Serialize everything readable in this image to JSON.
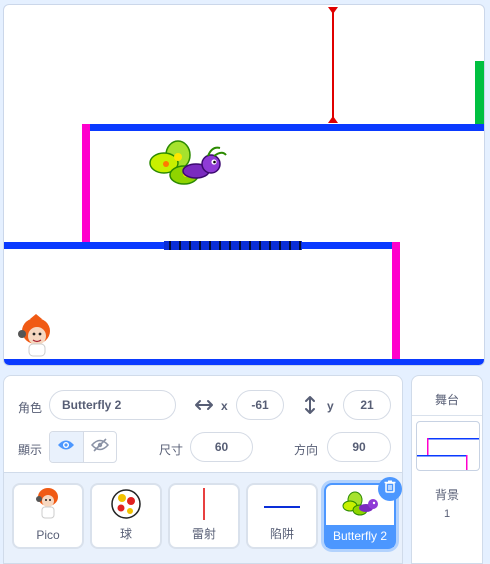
{
  "stage": {
    "colors": {
      "platform": "#0a3aff",
      "wall": "#ff00cc",
      "laser": "#e00000",
      "flag": "#00c040"
    }
  },
  "sprite_info": {
    "sprite_label": "角色",
    "sprite_name": "Butterfly 2",
    "x_label": "x",
    "x_value": "-61",
    "y_label": "y",
    "y_value": "21",
    "show_label": "顯示",
    "size_label": "尺寸",
    "size_value": "60",
    "direction_label": "方向",
    "direction_value": "90"
  },
  "sprites": [
    {
      "name": "Pico",
      "icon": "pico-thumb"
    },
    {
      "name": "球",
      "icon": "ball-thumb"
    },
    {
      "name": "雷射",
      "icon": "laser-thumb"
    },
    {
      "name": "陷阱",
      "icon": "trap-thumb"
    },
    {
      "name": "Butterfly 2",
      "icon": "butterfly-thumb",
      "selected": true
    }
  ],
  "stage_pane": {
    "title": "舞台",
    "backdrop_label": "背景",
    "backdrop_count": "1"
  }
}
